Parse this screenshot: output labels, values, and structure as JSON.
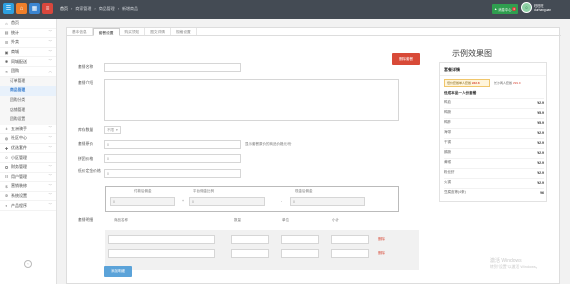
{
  "topbar": {
    "colors": [
      "#2da0e0",
      "#f07f2a",
      "#3b85d1",
      "#d9473d"
    ],
    "icons": [
      "dashboard-icon",
      "home-icon",
      "grid-icon",
      "list-icon"
    ],
    "crumbs": [
      "首页",
      "商家管理",
      "商品管理",
      "新增商品"
    ],
    "msg_label": "消息中心",
    "msg_count": "0",
    "user_name": "旺旺旺",
    "user_sub": "durhanguan"
  },
  "sidebar": {
    "items": [
      {
        "label": "首页",
        "icon": "⌂",
        "iconname": "home-icon",
        "chev": ""
      },
      {
        "label": "统计",
        "icon": "▤",
        "iconname": "chart-icon",
        "chev": "﹀"
      },
      {
        "label": "外卖",
        "icon": "☰",
        "iconname": "takeout-icon",
        "chev": "﹀"
      },
      {
        "label": "商城",
        "icon": "▣",
        "iconname": "mall-icon",
        "chev": "﹀"
      },
      {
        "label": "同城配送",
        "icon": "✱",
        "iconname": "delivery-icon",
        "chev": "﹀"
      },
      {
        "label": "团购",
        "icon": "∝",
        "iconname": "group-icon",
        "chev": "︿"
      }
    ],
    "subitems": [
      "订单管理",
      "商品管理",
      "团购分类",
      "店铺管理",
      "团购设置"
    ],
    "items2": [
      {
        "label": "五洲骑手",
        "icon": "ǂ",
        "iconname": "rider-icon",
        "chev": "﹀"
      },
      {
        "label": "社区中心",
        "icon": "◍",
        "iconname": "community-icon",
        "chev": "﹀"
      },
      {
        "label": "优选套件",
        "icon": "✚",
        "iconname": "suite-icon",
        "chev": "﹀"
      },
      {
        "label": "小区管理",
        "icon": "☺",
        "iconname": "district-icon",
        "chev": ""
      },
      {
        "label": "财务管理",
        "icon": "✪",
        "iconname": "finance-icon",
        "chev": "﹀"
      },
      {
        "label": "用户管理",
        "icon": "☷",
        "iconname": "users-icon",
        "chev": "﹀"
      },
      {
        "label": "营销装修",
        "icon": "$",
        "iconname": "marketing-icon",
        "chev": "﹀"
      },
      {
        "label": "系统设置",
        "icon": "✲",
        "iconname": "settings-icon",
        "chev": "﹀"
      },
      {
        "label": "产品程序",
        "icon": "◐",
        "iconname": "product-icon",
        "chev": "﹀"
      }
    ]
  },
  "tabs": [
    "基本信息",
    "套餐设置",
    "购买须知",
    "图文详情",
    "规格设置"
  ],
  "form": {
    "name_label": "套餐名称",
    "intro_label": "套餐介绍",
    "stock_label": "库存数量",
    "stock_value": "不限",
    "price_label": "套餐原价",
    "price_value": "0",
    "price_hint": "显示套餐原价的商品价格",
    "price_hint2": "元/份",
    "group_label": "拼团价格",
    "group_value": "0",
    "deposit_label": "低价定金价格",
    "deposit_value": "0",
    "delete_btn": "删除套餐",
    "box_headers": [
      "付款后佣金",
      "平台佣金比例",
      "现金后佣金"
    ],
    "box_values": [
      "0",
      "0",
      "0"
    ],
    "box_ops": [
      "+",
      "-"
    ],
    "detail_label": "套餐明细",
    "detail_headers": [
      "商品名称",
      "数量",
      "单位",
      "小计"
    ],
    "delete_text": "删除",
    "add_btn": "添加明细"
  },
  "preview": {
    "title": "示例效果图",
    "card_title": "套餐详情",
    "badge1_label": "低价套餐单人套餐",
    "badge1_price": "¥32.8",
    "badge2_label": "长沙两人套餐",
    "badge2_price": "¥99.9",
    "section": "低成本品一人份套餐",
    "rows": [
      [
        "鸭血",
        "¥2.9"
      ],
      [
        "鸭肠",
        "¥5.9"
      ],
      [
        "鸭胗",
        "¥5.9"
      ],
      [
        "海带",
        "¥2.9"
      ],
      [
        "干锅",
        "¥2.9"
      ],
      [
        "鹅肠",
        "¥2.9"
      ],
      [
        "黄喉",
        "¥2.9"
      ],
      [
        "粉丝虾",
        "¥2.9"
      ],
      [
        "火锅",
        "¥2.9"
      ],
      [
        "豆腐皮等(4条)",
        "¥6"
      ]
    ]
  },
  "watermark": [
    "激活 Windows",
    "转到\"设置\"以激活 Windows。"
  ]
}
